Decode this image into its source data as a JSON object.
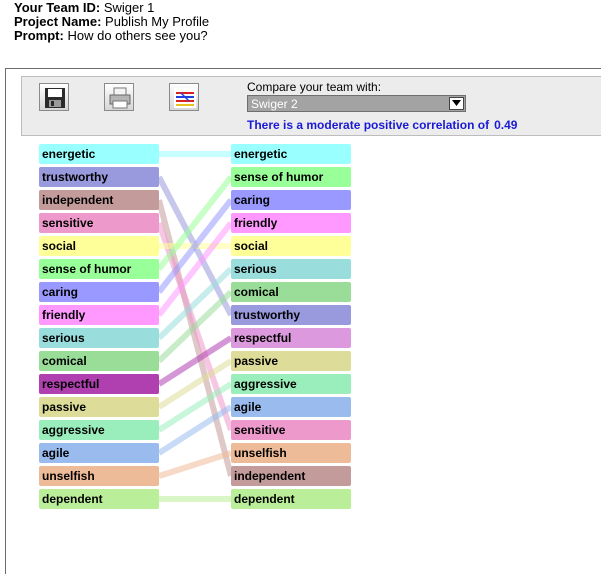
{
  "header": {
    "team_id_label": "Your Team ID:",
    "team_id": "Swiger 1",
    "project_label": "Project Name:",
    "project": "Publish My Profile",
    "prompt_label": "Prompt:",
    "prompt": "How do others see you?"
  },
  "toolbar": {
    "buttons": [
      "save-icon",
      "print-icon",
      "compare-lines-icon"
    ],
    "compare_label": "Compare your team with:",
    "compare_selected": "Swiger 2",
    "correlation_text": "There is a moderate positive correlation of",
    "correlation_value": "0.49"
  },
  "left_list": [
    {
      "label": "energetic",
      "color": "#99ffff"
    },
    {
      "label": "trustworthy",
      "color": "#9999dd"
    },
    {
      "label": "independent",
      "color": "#c49b9b"
    },
    {
      "label": "sensitive",
      "color": "#ee99cc"
    },
    {
      "label": "social",
      "color": "#ffff99"
    },
    {
      "label": "sense of humor",
      "color": "#99ff99"
    },
    {
      "label": "caring",
      "color": "#9999ff"
    },
    {
      "label": "friendly",
      "color": "#ff99ff"
    },
    {
      "label": "serious",
      "color": "#99dddd"
    },
    {
      "label": "comical",
      "color": "#99dd99"
    },
    {
      "label": "respectful",
      "color": "#b040b0"
    },
    {
      "label": "passive",
      "color": "#dddd99"
    },
    {
      "label": "aggressive",
      "color": "#99eebb"
    },
    {
      "label": "agile",
      "color": "#99bbee"
    },
    {
      "label": "unselfish",
      "color": "#eebb99"
    },
    {
      "label": "dependent",
      "color": "#bbee99"
    }
  ],
  "right_list": [
    {
      "label": "energetic",
      "color": "#99ffff"
    },
    {
      "label": "sense of humor",
      "color": "#99ff99"
    },
    {
      "label": "caring",
      "color": "#9999ff"
    },
    {
      "label": "friendly",
      "color": "#ff99ff"
    },
    {
      "label": "social",
      "color": "#ffff99"
    },
    {
      "label": "serious",
      "color": "#99dddd"
    },
    {
      "label": "comical",
      "color": "#99dd99"
    },
    {
      "label": "trustworthy",
      "color": "#9999dd"
    },
    {
      "label": "respectful",
      "color": "#dd99dd"
    },
    {
      "label": "passive",
      "color": "#dddd99"
    },
    {
      "label": "aggressive",
      "color": "#99eebb"
    },
    {
      "label": "agile",
      "color": "#99bbee"
    },
    {
      "label": "sensitive",
      "color": "#ee99cc"
    },
    {
      "label": "unselfish",
      "color": "#eebb99"
    },
    {
      "label": "independent",
      "color": "#c49b9b"
    },
    {
      "label": "dependent",
      "color": "#bbee99"
    }
  ]
}
